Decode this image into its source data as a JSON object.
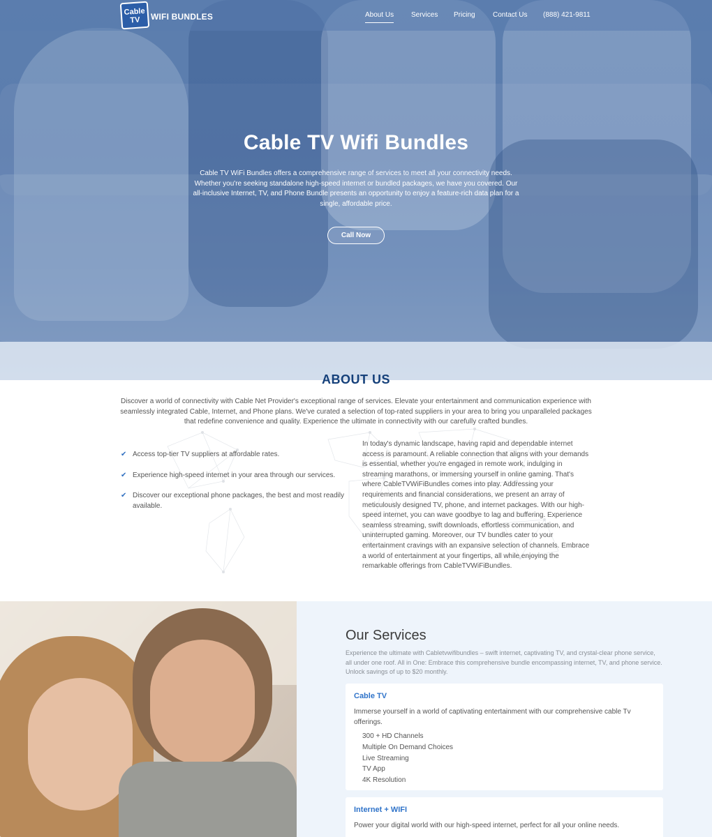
{
  "brand": {
    "logo_top": "Cable",
    "logo_bottom": "TV",
    "logo_text": "WIFI BUNDLES"
  },
  "nav": {
    "items": [
      {
        "label": "About Us",
        "active": true
      },
      {
        "label": "Services"
      },
      {
        "label": "Pricing"
      },
      {
        "label": "Contact Us"
      },
      {
        "label": "(888) 421-9811"
      }
    ]
  },
  "hero": {
    "title": "Cable TV Wifi Bundles",
    "description": "Cable TV WiFi Bundles offers a comprehensive range of services to meet all your connectivity needs. Whether you're seeking standalone high-speed internet or bundled packages, we have you covered. Our all-inclusive Internet, TV, and Phone Bundle presents an opportunity to enjoy a feature-rich data plan for a single, affordable price.",
    "cta": "Call Now"
  },
  "about": {
    "title": "ABOUT US",
    "intro": "Discover a world of connectivity with Cable Net Provider's exceptional range of services. Elevate your entertainment and communication experience with seamlessly integrated Cable, Internet, and Phone plans. We've curated a selection of top-rated suppliers in your area to bring you unparalleled packages that redefine convenience and quality. Experience the ultimate in connectivity with our carefully crafted bundles.",
    "bullets": [
      "Access top-tier TV suppliers at affordable rates.",
      "Experience high-speed internet in your area through our services.",
      "Discover our exceptional phone packages, the best and most readily available."
    ],
    "body": "In today's dynamic landscape, having rapid and dependable internet access is paramount. A reliable connection that aligns with your demands is essential, whether you're engaged in remote work, indulging in streaming marathons, or immersing yourself in online gaming. That's where CableTVWiFiBundles comes into play. Addressing your requirements and financial considerations, we present an array of meticulously designed TV, phone, and internet packages. With our high-speed internet, you can wave goodbye to lag and buffering. Experience seamless streaming, swift downloads, effortless communication, and uninterrupted gaming. Moreover, our TV bundles cater to your entertainment cravings with an expansive selection of channels. Embrace a world of entertainment at your fingertips, all while enjoying the remarkable offerings from CableTVWiFiBundles."
  },
  "services": {
    "title": "Our Services",
    "description": "Experience the ultimate with Cabletvwifibundles – swift internet, captivating TV, and crystal-clear phone service, all under one roof. All in One: Embrace this comprehensive bundle encompassing internet, TV, and phone service. Unlock savings of up to $20 monthly.",
    "cards": [
      {
        "title": "Cable TV",
        "text": "Immerse yourself in a world of captivating entertainment with our comprehensive cable Tv offerings.",
        "features": [
          "300 + HD Channels",
          "Multiple On Demand Choices",
          "Live Streaming",
          "TV App",
          "4K Resolution"
        ]
      },
      {
        "title": "Internet + WIFI",
        "text": "Power your digital world with our high-speed internet, perfect for all your online needs.",
        "features": []
      }
    ]
  },
  "colors": {
    "accent": "#15407a",
    "link_blue": "#2f73c9",
    "hero_overlay": "#5a7cae",
    "services_bg": "#eef4fb"
  }
}
